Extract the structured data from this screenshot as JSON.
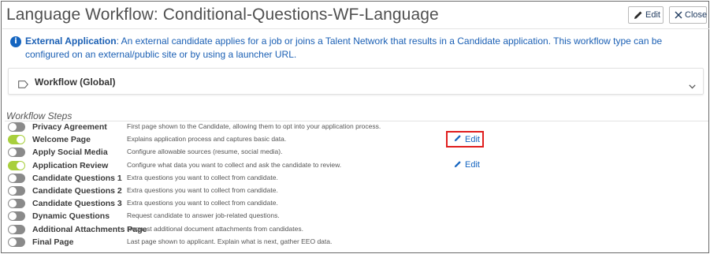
{
  "header": {
    "title": "Language Workflow: Conditional-Questions-WF-Language",
    "edit_label": "Edit",
    "close_label": "Close"
  },
  "info": {
    "bold": "External Application",
    "text": ": An external candidate applies for a job or joins a Talent Network that results in a Candidate application. This workflow type can be configured on an external/public site or by using a launcher URL."
  },
  "accordion": {
    "label": "Workflow (Global)"
  },
  "steps_section": {
    "label": "Workflow Steps",
    "edit_label": "Edit",
    "steps": [
      {
        "name": "Privacy Agreement",
        "desc": "First page shown to the Candidate, allowing them to opt into your application process.",
        "enabled": false,
        "editable": false
      },
      {
        "name": "Welcome Page",
        "desc": "Explains application process and captures basic data.",
        "enabled": true,
        "editable": true
      },
      {
        "name": "Apply Social Media",
        "desc": "Configure allowable sources (resume, social media).",
        "enabled": false,
        "editable": false
      },
      {
        "name": "Application Review",
        "desc": "Configure what data you want to collect and ask the candidate to review.",
        "enabled": true,
        "editable": true
      },
      {
        "name": "Candidate Questions 1",
        "desc": "Extra questions you want to collect from candidate.",
        "enabled": false,
        "editable": false
      },
      {
        "name": "Candidate Questions 2",
        "desc": "Extra questions you want to collect from candidate.",
        "enabled": false,
        "editable": false
      },
      {
        "name": "Candidate Questions 3",
        "desc": "Extra questions you want to collect from candidate.",
        "enabled": false,
        "editable": false
      },
      {
        "name": "Dynamic Questions",
        "desc": "Request candidate to answer job-related questions.",
        "enabled": false,
        "editable": false
      },
      {
        "name": "Additional Attachments Page",
        "desc": "Request additional document attachments from candidates.",
        "enabled": false,
        "editable": false
      },
      {
        "name": "Final Page",
        "desc": "Last page shown to applicant. Explain what is next, gather EEO data.",
        "enabled": false,
        "editable": false
      }
    ]
  },
  "colors": {
    "toggle_on": "#a8cf3c",
    "toggle_off": "#8a8a8a",
    "link": "#1565c0",
    "highlight": "#e01e1e"
  }
}
